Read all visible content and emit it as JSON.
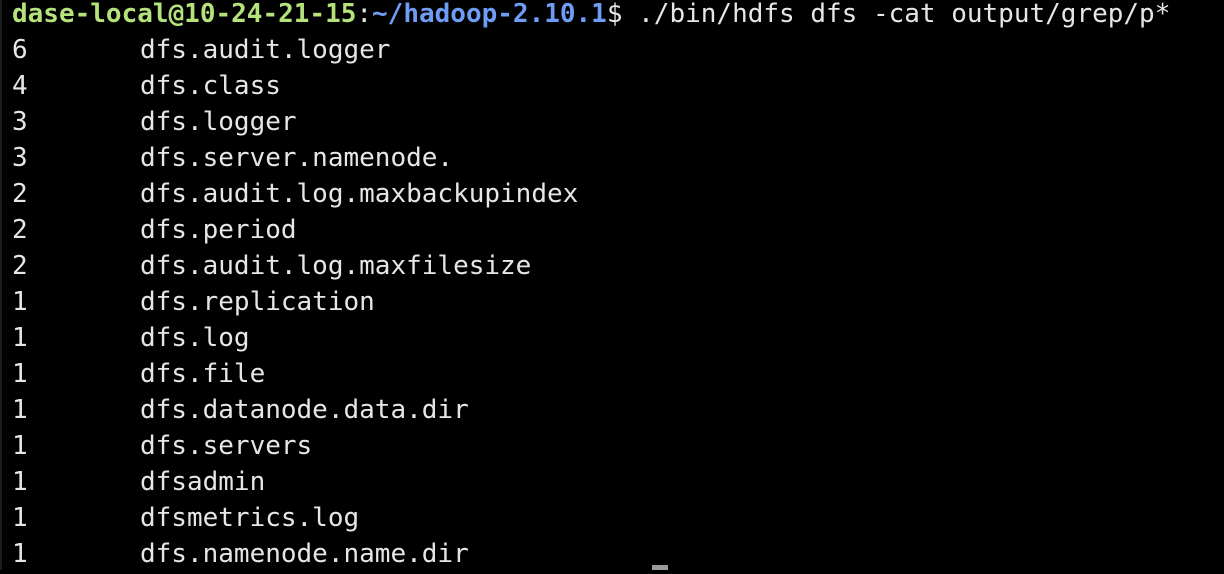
{
  "prompt": {
    "user_host": "dase-local@10-24-21-15",
    "separator": ":",
    "cwd": "~/hadoop-2.10.1",
    "symbol": "$",
    "command": " ./bin/hdfs dfs -cat output/grep/p*"
  },
  "output": [
    {
      "count": "6",
      "key": "dfs.audit.logger"
    },
    {
      "count": "4",
      "key": "dfs.class"
    },
    {
      "count": "3",
      "key": "dfs.logger"
    },
    {
      "count": "3",
      "key": "dfs.server.namenode."
    },
    {
      "count": "2",
      "key": "dfs.audit.log.maxbackupindex"
    },
    {
      "count": "2",
      "key": "dfs.period"
    },
    {
      "count": "2",
      "key": "dfs.audit.log.maxfilesize"
    },
    {
      "count": "1",
      "key": "dfs.replication"
    },
    {
      "count": "1",
      "key": "dfs.log"
    },
    {
      "count": "1",
      "key": "dfs.file"
    },
    {
      "count": "1",
      "key": "dfs.datanode.data.dir"
    },
    {
      "count": "1",
      "key": "dfs.servers"
    },
    {
      "count": "1",
      "key": "dfsadmin"
    },
    {
      "count": "1",
      "key": "dfsmetrics.log"
    },
    {
      "count": "1",
      "key": "dfs.namenode.name.dir"
    }
  ],
  "colors": {
    "background": "#000000",
    "user_host": "#b5e27a",
    "path": "#6f9df5",
    "text": "#e6e6e6"
  }
}
